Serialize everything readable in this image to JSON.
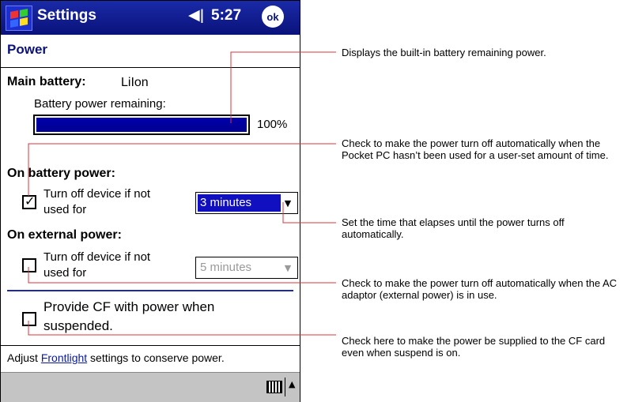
{
  "titlebar": {
    "app_title": "Settings",
    "time": "5:27",
    "ok_label": "ok"
  },
  "page": {
    "title": "Power"
  },
  "battery": {
    "label": "Main battery:",
    "type": "LiIon",
    "remaining_label": "Battery power remaining:",
    "percent_text": "100%",
    "percent_value": 100
  },
  "on_battery": {
    "heading": "On battery power:",
    "checkbox_line1": "Turn off device if not",
    "checkbox_line2": "used for",
    "checked": true,
    "dropdown_value": "3 minutes"
  },
  "on_external": {
    "heading": "On external power:",
    "checkbox_line1": "Turn off device if not",
    "checkbox_line2": "used for",
    "checked": false,
    "dropdown_value": "5 minutes"
  },
  "cf": {
    "line1": "Provide CF with power when",
    "line2": "suspended.",
    "checked": false
  },
  "footer": {
    "prefix": "Adjust ",
    "link": "Frontlight",
    "suffix": " settings to conserve power."
  },
  "callouts": [
    "Displays the built-in battery remaining power.",
    "Check to make the power turn off automatically when the Pocket PC hasn’t been used for a user-set amount of time.",
    "Set the time that elapses until the power turns off automatically.",
    "Check to make the power turn off automatically when the AC adaptor (external power) is in use.",
    "Check here to make the power be supplied to the CF card even when suspend is on."
  ],
  "colors": {
    "titlebar": "#0a127a",
    "accent": "#1010c0",
    "callout_line": "#d9363e"
  }
}
